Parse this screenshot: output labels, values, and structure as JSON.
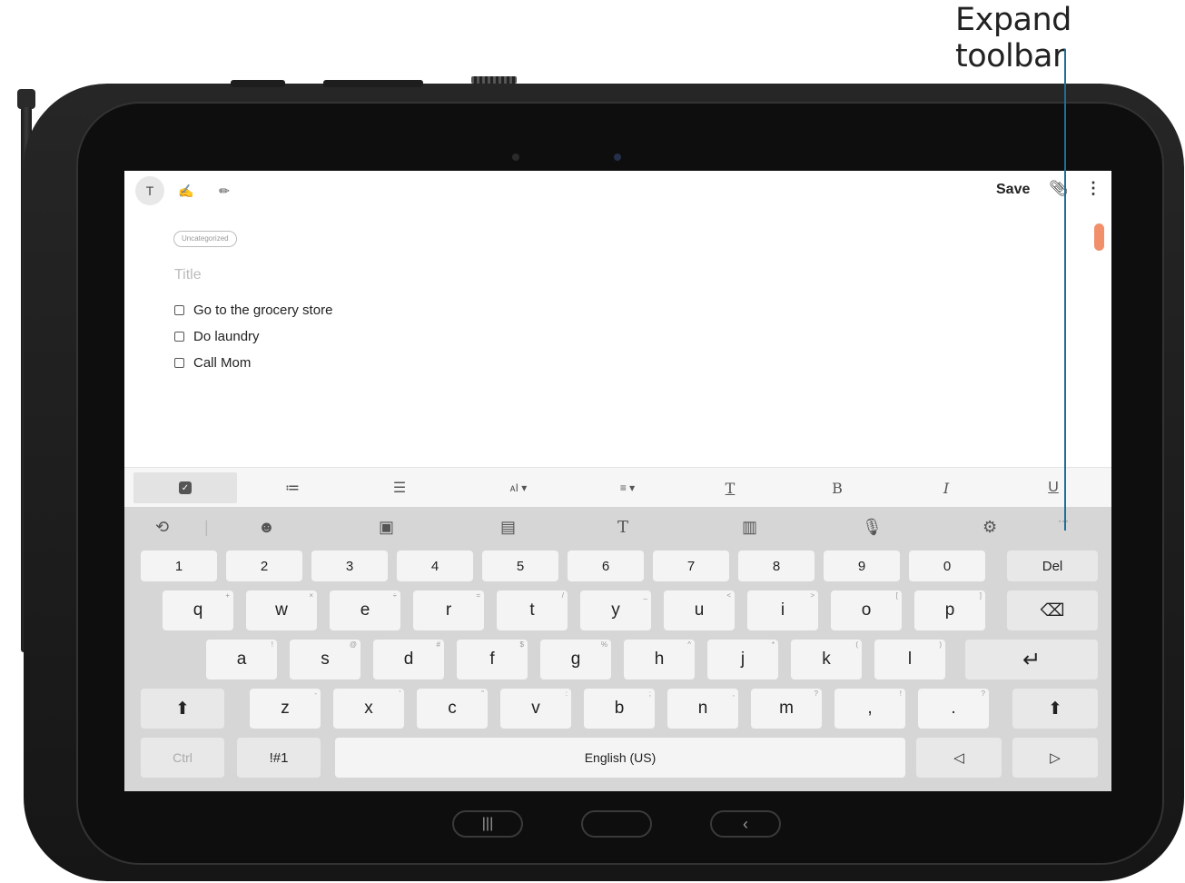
{
  "callout": {
    "label": "Expand toolbar"
  },
  "appbar": {
    "text_mode_icon": "T",
    "save_label": "Save"
  },
  "note": {
    "category": "Uncategorized",
    "title_placeholder": "Title",
    "checklist": [
      {
        "text": "Go to the grocery store",
        "checked": false
      },
      {
        "text": "Do laundry",
        "checked": false
      },
      {
        "text": "Call Mom",
        "checked": false
      }
    ]
  },
  "format_toolbar": {
    "items": [
      {
        "name": "checkbox-list",
        "glyph": "✓",
        "active": true
      },
      {
        "name": "numbered-list",
        "glyph": "≔"
      },
      {
        "name": "bulleted-list",
        "glyph": "☰"
      },
      {
        "name": "font-size",
        "glyph": "ᴀI ▾"
      },
      {
        "name": "alignment",
        "glyph": "≡ ▾"
      },
      {
        "name": "text-color",
        "glyph": "T"
      },
      {
        "name": "bold",
        "glyph": "B"
      },
      {
        "name": "italic",
        "glyph": "I"
      },
      {
        "name": "underline",
        "glyph": "U"
      }
    ]
  },
  "keyboard": {
    "toolbar_icons": [
      "text-cursor-icon",
      "emoji-icon",
      "sticker-icon",
      "gif-icon",
      "handwriting-icon",
      "clipboard-icon",
      "microphone-icon",
      "settings-icon",
      "expand-toolbar-icon"
    ],
    "number_row": [
      "1",
      "2",
      "3",
      "4",
      "5",
      "6",
      "7",
      "8",
      "9",
      "0"
    ],
    "del_label": "Del",
    "row1": [
      {
        "key": "q",
        "hint": "+"
      },
      {
        "key": "w",
        "hint": "×"
      },
      {
        "key": "e",
        "hint": "÷"
      },
      {
        "key": "r",
        "hint": "="
      },
      {
        "key": "t",
        "hint": "/"
      },
      {
        "key": "y",
        "hint": "_"
      },
      {
        "key": "u",
        "hint": "<"
      },
      {
        "key": "i",
        "hint": ">"
      },
      {
        "key": "o",
        "hint": "["
      },
      {
        "key": "p",
        "hint": "]"
      }
    ],
    "row2": [
      {
        "key": "a",
        "hint": "!"
      },
      {
        "key": "s",
        "hint": "@"
      },
      {
        "key": "d",
        "hint": "#"
      },
      {
        "key": "f",
        "hint": "$"
      },
      {
        "key": "g",
        "hint": "%"
      },
      {
        "key": "h",
        "hint": "^"
      },
      {
        "key": "j",
        "hint": "*"
      },
      {
        "key": "k",
        "hint": "("
      },
      {
        "key": "l",
        "hint": ")"
      }
    ],
    "row3": [
      {
        "key": "z",
        "hint": "-"
      },
      {
        "key": "x",
        "hint": "'"
      },
      {
        "key": "c",
        "hint": "\""
      },
      {
        "key": "v",
        "hint": ":"
      },
      {
        "key": "b",
        "hint": ";"
      },
      {
        "key": "n",
        "hint": ","
      },
      {
        "key": "m",
        "hint": "?"
      }
    ],
    "comma_key": ",",
    "comma_hint": "!",
    "period_key": ".",
    "period_hint": "?",
    "ctrl_label": "Ctrl",
    "symbols_label": "!#1",
    "space_label": "English (US)"
  }
}
